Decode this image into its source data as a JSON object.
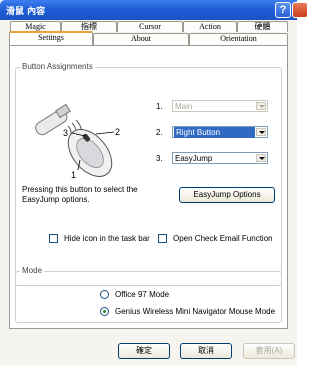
{
  "window": {
    "title": "滑鼠 內容",
    "help_label": "?"
  },
  "tabs_row1": [
    "Magic",
    "指標",
    "Cursor",
    "Action",
    "硬體"
  ],
  "tabs_row2": [
    "Settings",
    "About",
    "Orientation"
  ],
  "active_tab": "Settings",
  "button_assignments": {
    "group_label": "Button Assignments",
    "mouse_callouts": [
      "3",
      "2",
      "1"
    ],
    "rows": [
      {
        "number": "1.",
        "value": "Main",
        "enabled": false
      },
      {
        "number": "2.",
        "value": "Right Button",
        "enabled": true,
        "selected": true
      },
      {
        "number": "3.",
        "value": "EasyJump",
        "enabled": true
      }
    ],
    "description": "Pressing this button to select the EasyJump options.",
    "options_button": "EasyJump Options",
    "hide_icon_label": "Hide icon in the task bar",
    "open_check_label": "Open Check Email Function"
  },
  "mode": {
    "group_label": "Mode",
    "options": [
      {
        "label": "Office 97 Mode",
        "checked": false
      },
      {
        "label": "Genius Wireless Mini Navigator Mouse Mode",
        "checked": true
      }
    ]
  },
  "footer": {
    "ok_label": "確定",
    "cancel_label": "取消",
    "apply_label": "套用(A)"
  },
  "colors": {
    "titlebar": "#1f5fd8",
    "selection": "#316ac5",
    "active_tab_accent": "#e8a33c"
  }
}
